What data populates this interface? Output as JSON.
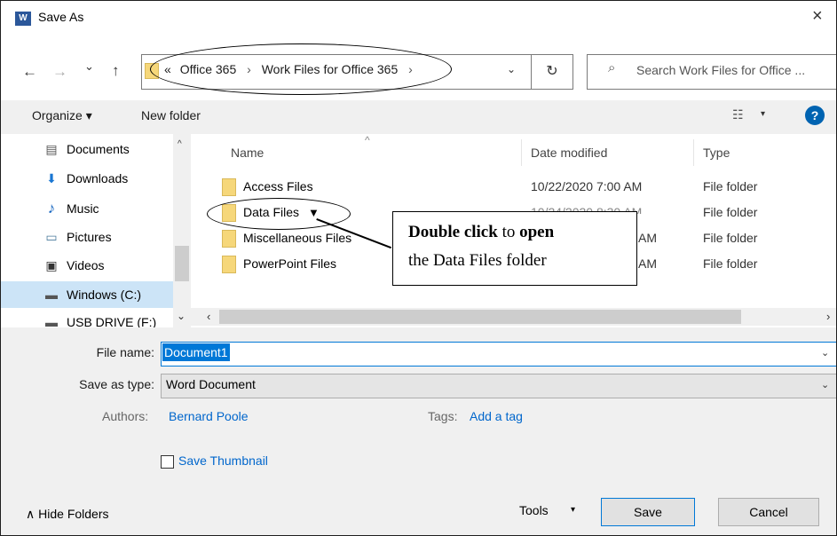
{
  "window": {
    "title": "Save As",
    "app_icon": "W",
    "close_glyph": "×"
  },
  "nav": {
    "back": "←",
    "forward": "→",
    "recent": "⌄",
    "up": "↑",
    "refresh": "↻"
  },
  "address": {
    "overflow": "«",
    "crumbs": [
      "Office 365",
      "Work Files for Office 365"
    ],
    "sep": "›",
    "trailing": "›",
    "dropdown": "⌄"
  },
  "search": {
    "placeholder": "Search Work Files for Office ..."
  },
  "toolbar": {
    "organize": "Organize ▾",
    "new_folder": "New folder",
    "view_glyph": "☷",
    "view_chev": "▾",
    "help": "?"
  },
  "navpane": {
    "items": [
      {
        "label": "Documents",
        "icon": "document-icon",
        "glyph": "▤"
      },
      {
        "label": "Downloads",
        "icon": "download-icon",
        "glyph": "⬇"
      },
      {
        "label": "Music",
        "icon": "music-icon",
        "glyph": "♪"
      },
      {
        "label": "Pictures",
        "icon": "pictures-icon",
        "glyph": "▭"
      },
      {
        "label": "Videos",
        "icon": "video-icon",
        "glyph": "▣"
      },
      {
        "label": "Windows (C:)",
        "icon": "drive-icon",
        "glyph": "▬"
      },
      {
        "label": "USB DRIVE (F:)",
        "icon": "usb-drive-icon",
        "glyph": "▬"
      }
    ],
    "scroll_up": "^",
    "scroll_down": "⌄"
  },
  "list": {
    "columns": {
      "name": "Name",
      "date": "Date modified",
      "type": "Type"
    },
    "sort_glyph": "^",
    "rows": [
      {
        "name": "Access Files",
        "date": "10/22/2020 7:00 AM",
        "type": "File folder"
      },
      {
        "name": "Data Files",
        "date": "10/24/2020 8:30 AM",
        "type": "File folder"
      },
      {
        "name": "Miscellaneous Files",
        "date": "AM",
        "type": "File folder"
      },
      {
        "name": "PowerPoint Files",
        "date": "AM",
        "type": "File folder"
      }
    ],
    "hscroll_left": "‹",
    "hscroll_right": "›"
  },
  "callout": {
    "bold1": "Double click",
    "text1": " to ",
    "bold2": "open",
    "line2": "the Data Files folder",
    "pointer": "▼"
  },
  "form": {
    "filename_label": "File name:",
    "filename_value": "Document1",
    "savetype_label": "Save as type:",
    "savetype_value": "Word Document",
    "chev": "⌄",
    "authors_label": "Authors:",
    "authors_value": "Bernard Poole",
    "tags_label": "Tags:",
    "tags_value": "Add a tag",
    "thumbnail_label": "Save Thumbnail"
  },
  "footer": {
    "hide_folders": "∧  Hide Folders",
    "tools": "Tools",
    "tools_chev": "▾",
    "save": "Save",
    "cancel": "Cancel"
  }
}
